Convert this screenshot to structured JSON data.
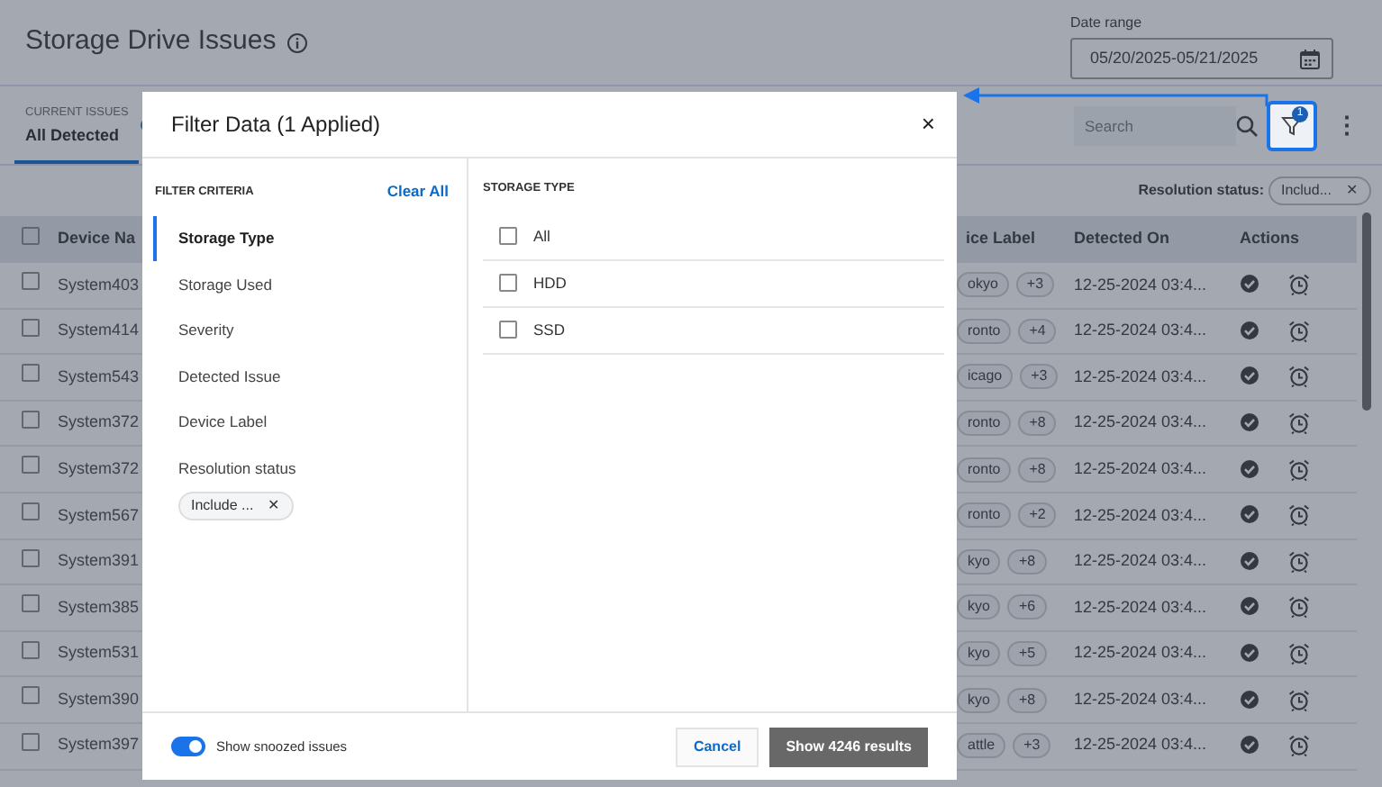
{
  "page": {
    "title": "Storage Drive Issues",
    "date_range": {
      "label": "Date range",
      "value": "05/20/2025-05/21/2025"
    }
  },
  "tabs": [
    {
      "caption": "CURRENT ISSUES",
      "label": "All Detected",
      "selected": true
    }
  ],
  "search": {
    "placeholder": "Search"
  },
  "filter_button": {
    "badge": "1",
    "highlighted": true
  },
  "more_menu": "⋮",
  "resolution_filter": {
    "label": "Resolution status:",
    "chip": "Includ...",
    "remove": "✕"
  },
  "table": {
    "columns": [
      "Device Na",
      "ice Label",
      "Detected On",
      "Actions"
    ],
    "rows": [
      {
        "name": "System403",
        "checked": false,
        "label": "okyo",
        "more": "+3",
        "detected": "12-25-2024 03:4..."
      },
      {
        "name": "System414",
        "checked": false,
        "label": "ronto",
        "more": "+4",
        "detected": "12-25-2024 03:4..."
      },
      {
        "name": "System543",
        "checked": false,
        "label": "icago",
        "more": "+3",
        "detected": "12-25-2024 03:4..."
      },
      {
        "name": "System372",
        "checked": false,
        "label": "ronto",
        "more": "+8",
        "detected": "12-25-2024 03:4..."
      },
      {
        "name": "System372",
        "checked": false,
        "label": "ronto",
        "more": "+8",
        "detected": "12-25-2024 03:4..."
      },
      {
        "name": "System567",
        "checked": false,
        "label": "ronto",
        "more": "+2",
        "detected": "12-25-2024 03:4..."
      },
      {
        "name": "System391",
        "checked": false,
        "label": "kyo",
        "more": "+8",
        "detected": "12-25-2024 03:4..."
      },
      {
        "name": "System385",
        "checked": false,
        "label": "kyo",
        "more": "+6",
        "detected": "12-25-2024 03:4..."
      },
      {
        "name": "System531",
        "checked": false,
        "label": "kyo",
        "more": "+5",
        "detected": "12-25-2024 03:4..."
      },
      {
        "name": "System390",
        "checked": false,
        "label": "kyo",
        "more": "+8",
        "detected": "12-25-2024 03:4..."
      },
      {
        "name": "System397",
        "checked": false,
        "label": "attle",
        "more": "+3",
        "detected": "12-25-2024 03:4..."
      }
    ],
    "all_checked": false
  },
  "modal": {
    "title": "Filter Data (1 Applied)",
    "close": "×",
    "criteria_heading": "FILTER CRITERIA",
    "clear": "Clear All",
    "criteria": [
      {
        "label": "Storage Type",
        "selected": true
      },
      {
        "label": "Storage Used",
        "selected": false
      },
      {
        "label": "Severity",
        "selected": false
      },
      {
        "label": "Detected Issue",
        "selected": false
      },
      {
        "label": "Device Label",
        "selected": false
      },
      {
        "label": "Resolution status",
        "selected": false,
        "chip": "Include ...",
        "remove": "✕"
      }
    ],
    "options_heading": "STORAGE TYPE",
    "options": [
      {
        "label": "All",
        "checked": false
      },
      {
        "label": "HDD",
        "checked": false
      },
      {
        "label": "SSD",
        "checked": false
      }
    ],
    "snoozed": {
      "label": "Show snoozed issues",
      "on": true
    },
    "cancel": "Cancel",
    "apply": "Show 4246 results"
  }
}
